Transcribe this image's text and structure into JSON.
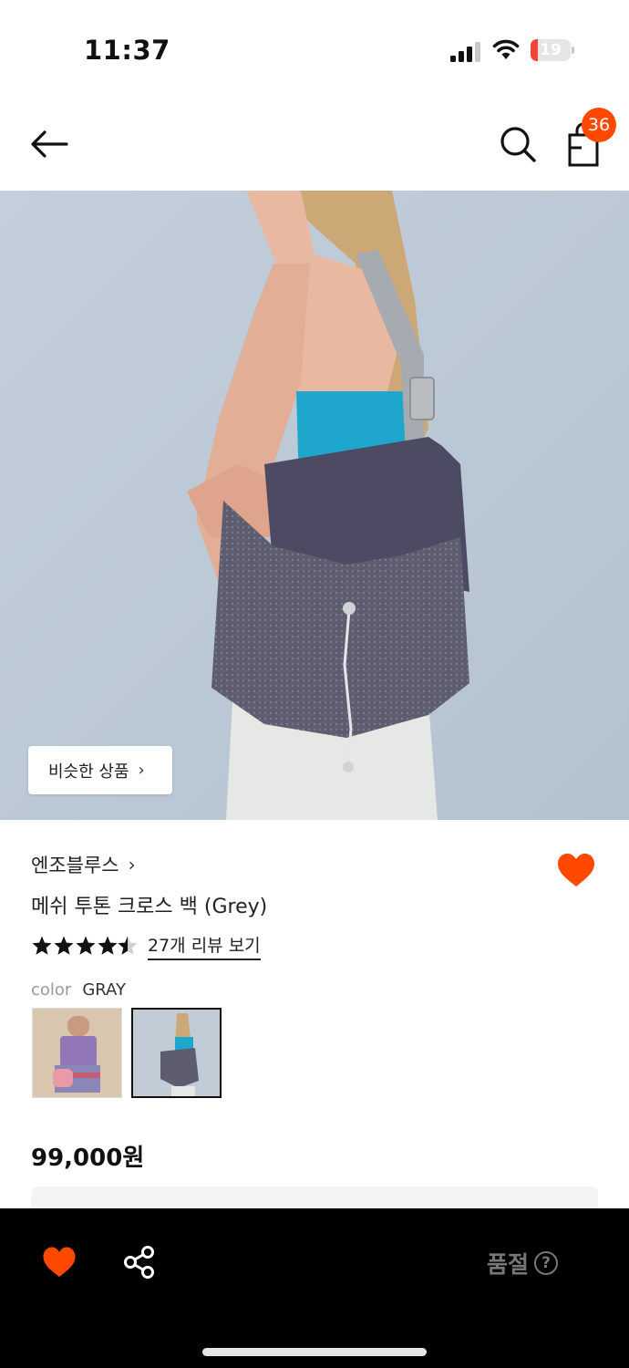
{
  "status_bar": {
    "time": "11:37",
    "battery": "19",
    "battery_level": 0.19,
    "icons": [
      "cellular-signal-icon",
      "wifi-icon",
      "battery-charging-icon"
    ]
  },
  "header": {
    "icons": [
      "back-arrow-icon",
      "search-icon",
      "shopping-bag-icon"
    ],
    "cart_count": "36"
  },
  "hero": {
    "similar_button_label": "비슷한 상품",
    "similar_button_chevron": "›"
  },
  "product": {
    "brand": "엔조블루스",
    "brand_chevron": "›",
    "name": "메쉬 투톤 크로스 백 (Grey)",
    "rating": 4.5,
    "review_link": "27개 리뷰 보기",
    "color_label": "color",
    "color_value": "GRAY",
    "color_options": [
      "purple-variant-thumbnail",
      "gray-variant-thumbnail"
    ],
    "selected_color_index": 1,
    "price": "99,000원"
  },
  "bottom_bar": {
    "icons": [
      "heart-icon",
      "share-icon",
      "help-icon"
    ],
    "status_label": "품절",
    "help_glyph": "?"
  },
  "colors": {
    "accent": "#ff4800",
    "bottom_bar": "#000000",
    "soldout_text": "#777777"
  }
}
